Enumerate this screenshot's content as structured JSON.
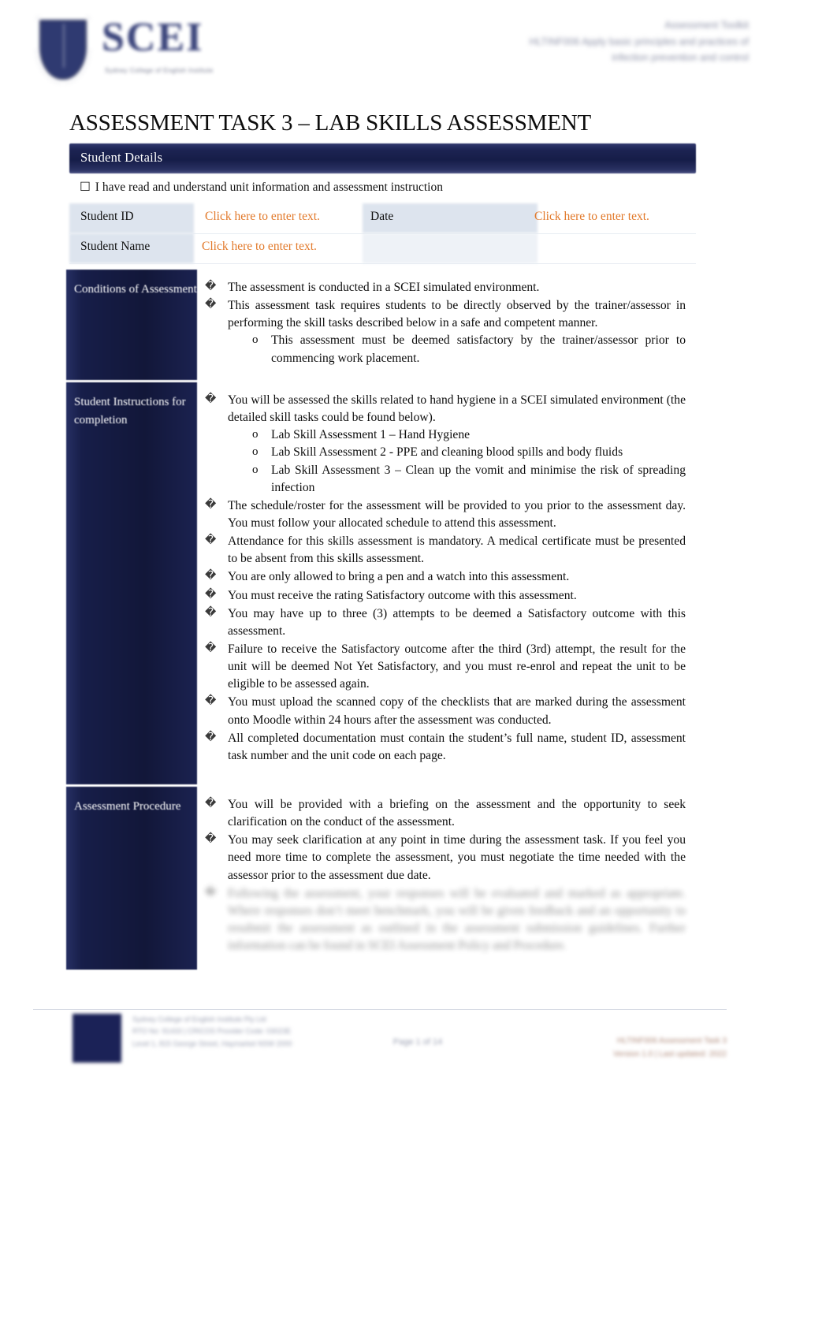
{
  "header": {
    "logo_text": "SCEI",
    "logo_subtitle": "Sydney College of English Institute",
    "right_lines": [
      "Assessment Toolkit",
      "HLTINF006 Apply basic principles and practices of",
      "infection prevention and control"
    ]
  },
  "title": "ASSESSMENT TASK 3 – LAB SKILLS ASSESSMENT",
  "student_details": {
    "section_label": "Student Details",
    "declaration_checkbox": "☐",
    "declaration": "I have read and understand unit information and assessment instruction",
    "fields": [
      {
        "label": "Student ID",
        "value": "Click here to enter text."
      },
      {
        "label": "Date",
        "value": "Click here to enter text."
      },
      {
        "label": "Student Name",
        "value": "Click here to enter text."
      }
    ]
  },
  "sections": [
    {
      "heading": "Conditions of Assessment",
      "bullets": [
        {
          "marker": "�",
          "text": "The assessment is conducted in a SCEI simulated environment.",
          "justify": false
        },
        {
          "marker": "�",
          "text": "This assessment task requires students to be directly observed by the trainer/assessor in performing the skill tasks described below in a safe and competent manner.",
          "justify": true,
          "sub": [
            {
              "marker": "o",
              "text": "This assessment must be deemed satisfactory by the trainer/assessor prior to commencing work placement.",
              "justify": true
            }
          ]
        }
      ]
    },
    {
      "heading": "Student Instructions for completion",
      "bullets": [
        {
          "marker": "�",
          "text": "You will be assessed the skills related to hand hygiene in a SCEI simulated environment (the detailed skill tasks could be found below).",
          "justify": false,
          "sub": [
            {
              "marker": "o",
              "text": "Lab Skill Assessment 1 – Hand Hygiene",
              "justify": false
            },
            {
              "marker": "o",
              "text": "Lab Skill Assessment 2 - PPE and cleaning blood spills and body fluids",
              "justify": true
            },
            {
              "marker": "o",
              "text": "Lab Skill Assessment 3 – Clean up the vomit and minimise the risk of spreading infection",
              "justify": false
            }
          ]
        },
        {
          "marker": "�",
          "text": "The schedule/roster for the assessment will be provided to you prior to the assessment day. You must follow your allocated schedule to attend this assessment.",
          "justify": true
        },
        {
          "marker": "�",
          "text": "Attendance for this skills assessment is mandatory. A medical certificate must be presented to be absent from this skills assessment.",
          "justify": true
        },
        {
          "marker": "�",
          "text": "You are only allowed to bring a pen and a watch into this assessment.",
          "justify": false
        },
        {
          "marker": "�",
          "text": "You must receive the rating Satisfactory outcome with this assessment.",
          "justify": false
        },
        {
          "marker": "�",
          "text": "You may have up to three (3) attempts to be deemed a Satisfactory outcome with this assessment.",
          "justify": true
        },
        {
          "marker": "�",
          "text": "Failure to receive the Satisfactory outcome after the third (3rd) attempt, the result for the unit will be deemed Not Yet Satisfactory, and you must re-enrol and repeat the unit to be eligible to be assessed again.",
          "justify": true
        },
        {
          "marker": "�",
          "text": "You must upload the scanned copy of the checklists that are marked during the assessment onto Moodle within 24 hours after the assessment was conducted.",
          "justify": true
        },
        {
          "marker": "�",
          "text": "All completed documentation must contain the student’s full name, student ID, assessment task number and the unit code on each page.",
          "justify": true,
          "indent": true
        }
      ]
    },
    {
      "heading": "Assessment Procedure",
      "bullets": [
        {
          "marker": "�",
          "text": "You will be provided with a briefing on the assessment and the opportunity to seek clarification on the conduct of the assessment.",
          "justify": true,
          "indent": true
        },
        {
          "marker": "�",
          "text": "You may seek clarification at any point in time during the assessment task. If you feel you need more time to complete the assessment, you must negotiate the time needed with the assessor prior to the assessment due date.",
          "justify": true,
          "indent": true
        }
      ],
      "obscured_bullets": [
        {
          "marker": "�",
          "text": "Following the assessment, your responses will be evaluated and marked as appropriate. Where responses don’t meet benchmark, you will be given feedback and an opportunity to resubmit the assessment as outlined in the assessment submission guidelines. Further information can be found in SCEI Assessment Policy and Procedure.",
          "justify": true,
          "indent": true
        }
      ]
    }
  ],
  "footer": {
    "left_lines": [
      "Sydney College of English Institute Pty Ltd",
      "RTO No: 91433 | CRICOS Provider Code: 03023E",
      "Level 1, 815 George Street, Haymarket NSW 2000"
    ],
    "center": "Page 1 of 14",
    "right_lines": [
      "HLTINF006 Assessment Task 3",
      "Version 1.0 | Last updated: 2022"
    ]
  }
}
